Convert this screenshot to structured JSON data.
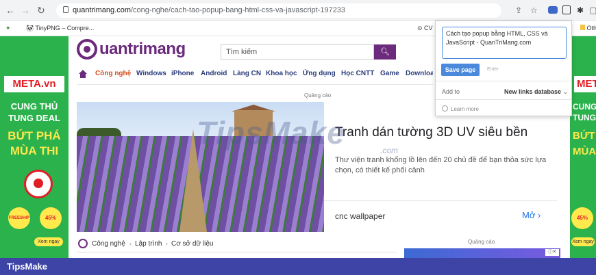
{
  "browser": {
    "url_domain": "quantrimang.com",
    "url_path": "/cong-nghe/cach-tao-popup-bang-html-css-va-javascript-197233"
  },
  "bookmarks": {
    "item1": "TinyPNG – Compre...",
    "item2": "CV",
    "item3": "Oth"
  },
  "site": {
    "logo_text": "uantrimang",
    "search_placeholder": "Tìm kiếm",
    "nav": [
      "Công nghệ",
      "Windows",
      "iPhone",
      "Android",
      "Làng CN",
      "Khoa học",
      "Ứng dụng",
      "Học CNTT",
      "Game",
      "Download"
    ],
    "ad_label": "Quảng cáo"
  },
  "left_ad": {
    "brand": "META.vn",
    "line1": "CUNG THỦ",
    "line2": "TUNG DEAL",
    "line3": "BỨT PHÁ",
    "line4": "MÙA THI",
    "freeship": "FREESHIP",
    "discount": "45%",
    "cta": "Xem ngay"
  },
  "right_ad": {
    "brand": "MET",
    "line1": "CUNG",
    "line2": "TUNG",
    "line3": "BỨT",
    "line4": "MÙA",
    "discount": "45%",
    "cta": "Xem ngay"
  },
  "hero": {
    "title": "Tranh dán tường 3D UV siêu bền",
    "desc": "Thư viện tranh khổng lồ lên đến 20 chủ đề để bạn thỏa sức lựa chọn, có thiết kế phối cảnh",
    "sponsor": "cnc wallpaper",
    "cta": "Mở"
  },
  "watermark": {
    "text": "TipsMake",
    "com": ".com"
  },
  "breadcrumb": [
    "Công nghệ",
    "Lập trình",
    "Cơ sở dữ liệu"
  ],
  "popup": {
    "title_text": "Cách tạo popup bằng HTML, CSS và JavaScript - QuanTriMang.com",
    "save_label": "Save page",
    "enter_hint": "Enter",
    "add_to_label": "Add to",
    "database": "New links database",
    "learn_more": "Learn more"
  },
  "footer": {
    "brand": "TipsMake"
  },
  "colors": {
    "brand_purple": "#6b2a7c",
    "ad_green": "#2bb24c",
    "footer_blue": "#3e44a6",
    "button_blue": "#4a89dc"
  }
}
